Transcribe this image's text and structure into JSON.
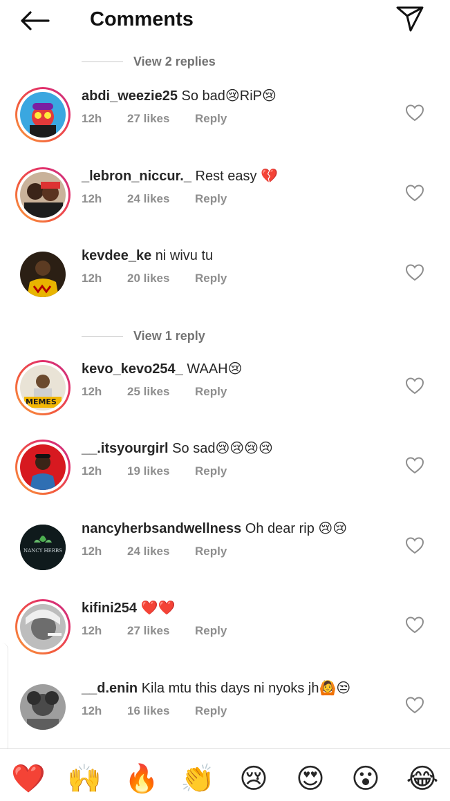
{
  "header": {
    "title": "Comments"
  },
  "view_replies_top": "View 2 replies",
  "view_replies_mid": "View 1 reply",
  "comments": [
    {
      "user": "abdi_weezie25",
      "text": "So bad😢RiP😢",
      "time": "12h",
      "likes": "27 likes",
      "reply": "Reply"
    },
    {
      "user": "_lebron_niccur._",
      "text": "Rest easy 💔",
      "time": "12h",
      "likes": "24 likes",
      "reply": "Reply"
    },
    {
      "user": "kevdee_ke",
      "text": "ni wivu tu",
      "time": "12h",
      "likes": "20 likes",
      "reply": "Reply"
    },
    {
      "user": "kevo_kevo254_",
      "text": "WAAH😢",
      "time": "12h",
      "likes": "25 likes",
      "reply": "Reply",
      "avatar_badge": "MEMES"
    },
    {
      "user": "__.itsyourgirl",
      "text": "So sad😢😢😢😢",
      "time": "12h",
      "likes": "19 likes",
      "reply": "Reply"
    },
    {
      "user": "nancyherbsandwellness",
      "text": "Oh dear rip 😢😢",
      "time": "12h",
      "likes": "24 likes",
      "reply": "Reply",
      "avatar_badge": "NANCY HERBS"
    },
    {
      "user": "kifini254",
      "text": "❤️❤️",
      "time": "12h",
      "likes": "27 likes",
      "reply": "Reply"
    },
    {
      "user": "__d.enin",
      "text": "Kila mtu this days ni nyoks jh🙆😒",
      "time": "12h",
      "likes": "16 likes",
      "reply": "Reply"
    }
  ],
  "emoji_bar": [
    "❤️",
    "🙌",
    "🔥",
    "👏",
    "😢",
    "😍",
    "😮",
    "😂"
  ],
  "colors": {
    "story_ring_start": "#f9a03f",
    "story_ring_end": "#c13584",
    "meta_text": "#8e8e8e"
  }
}
